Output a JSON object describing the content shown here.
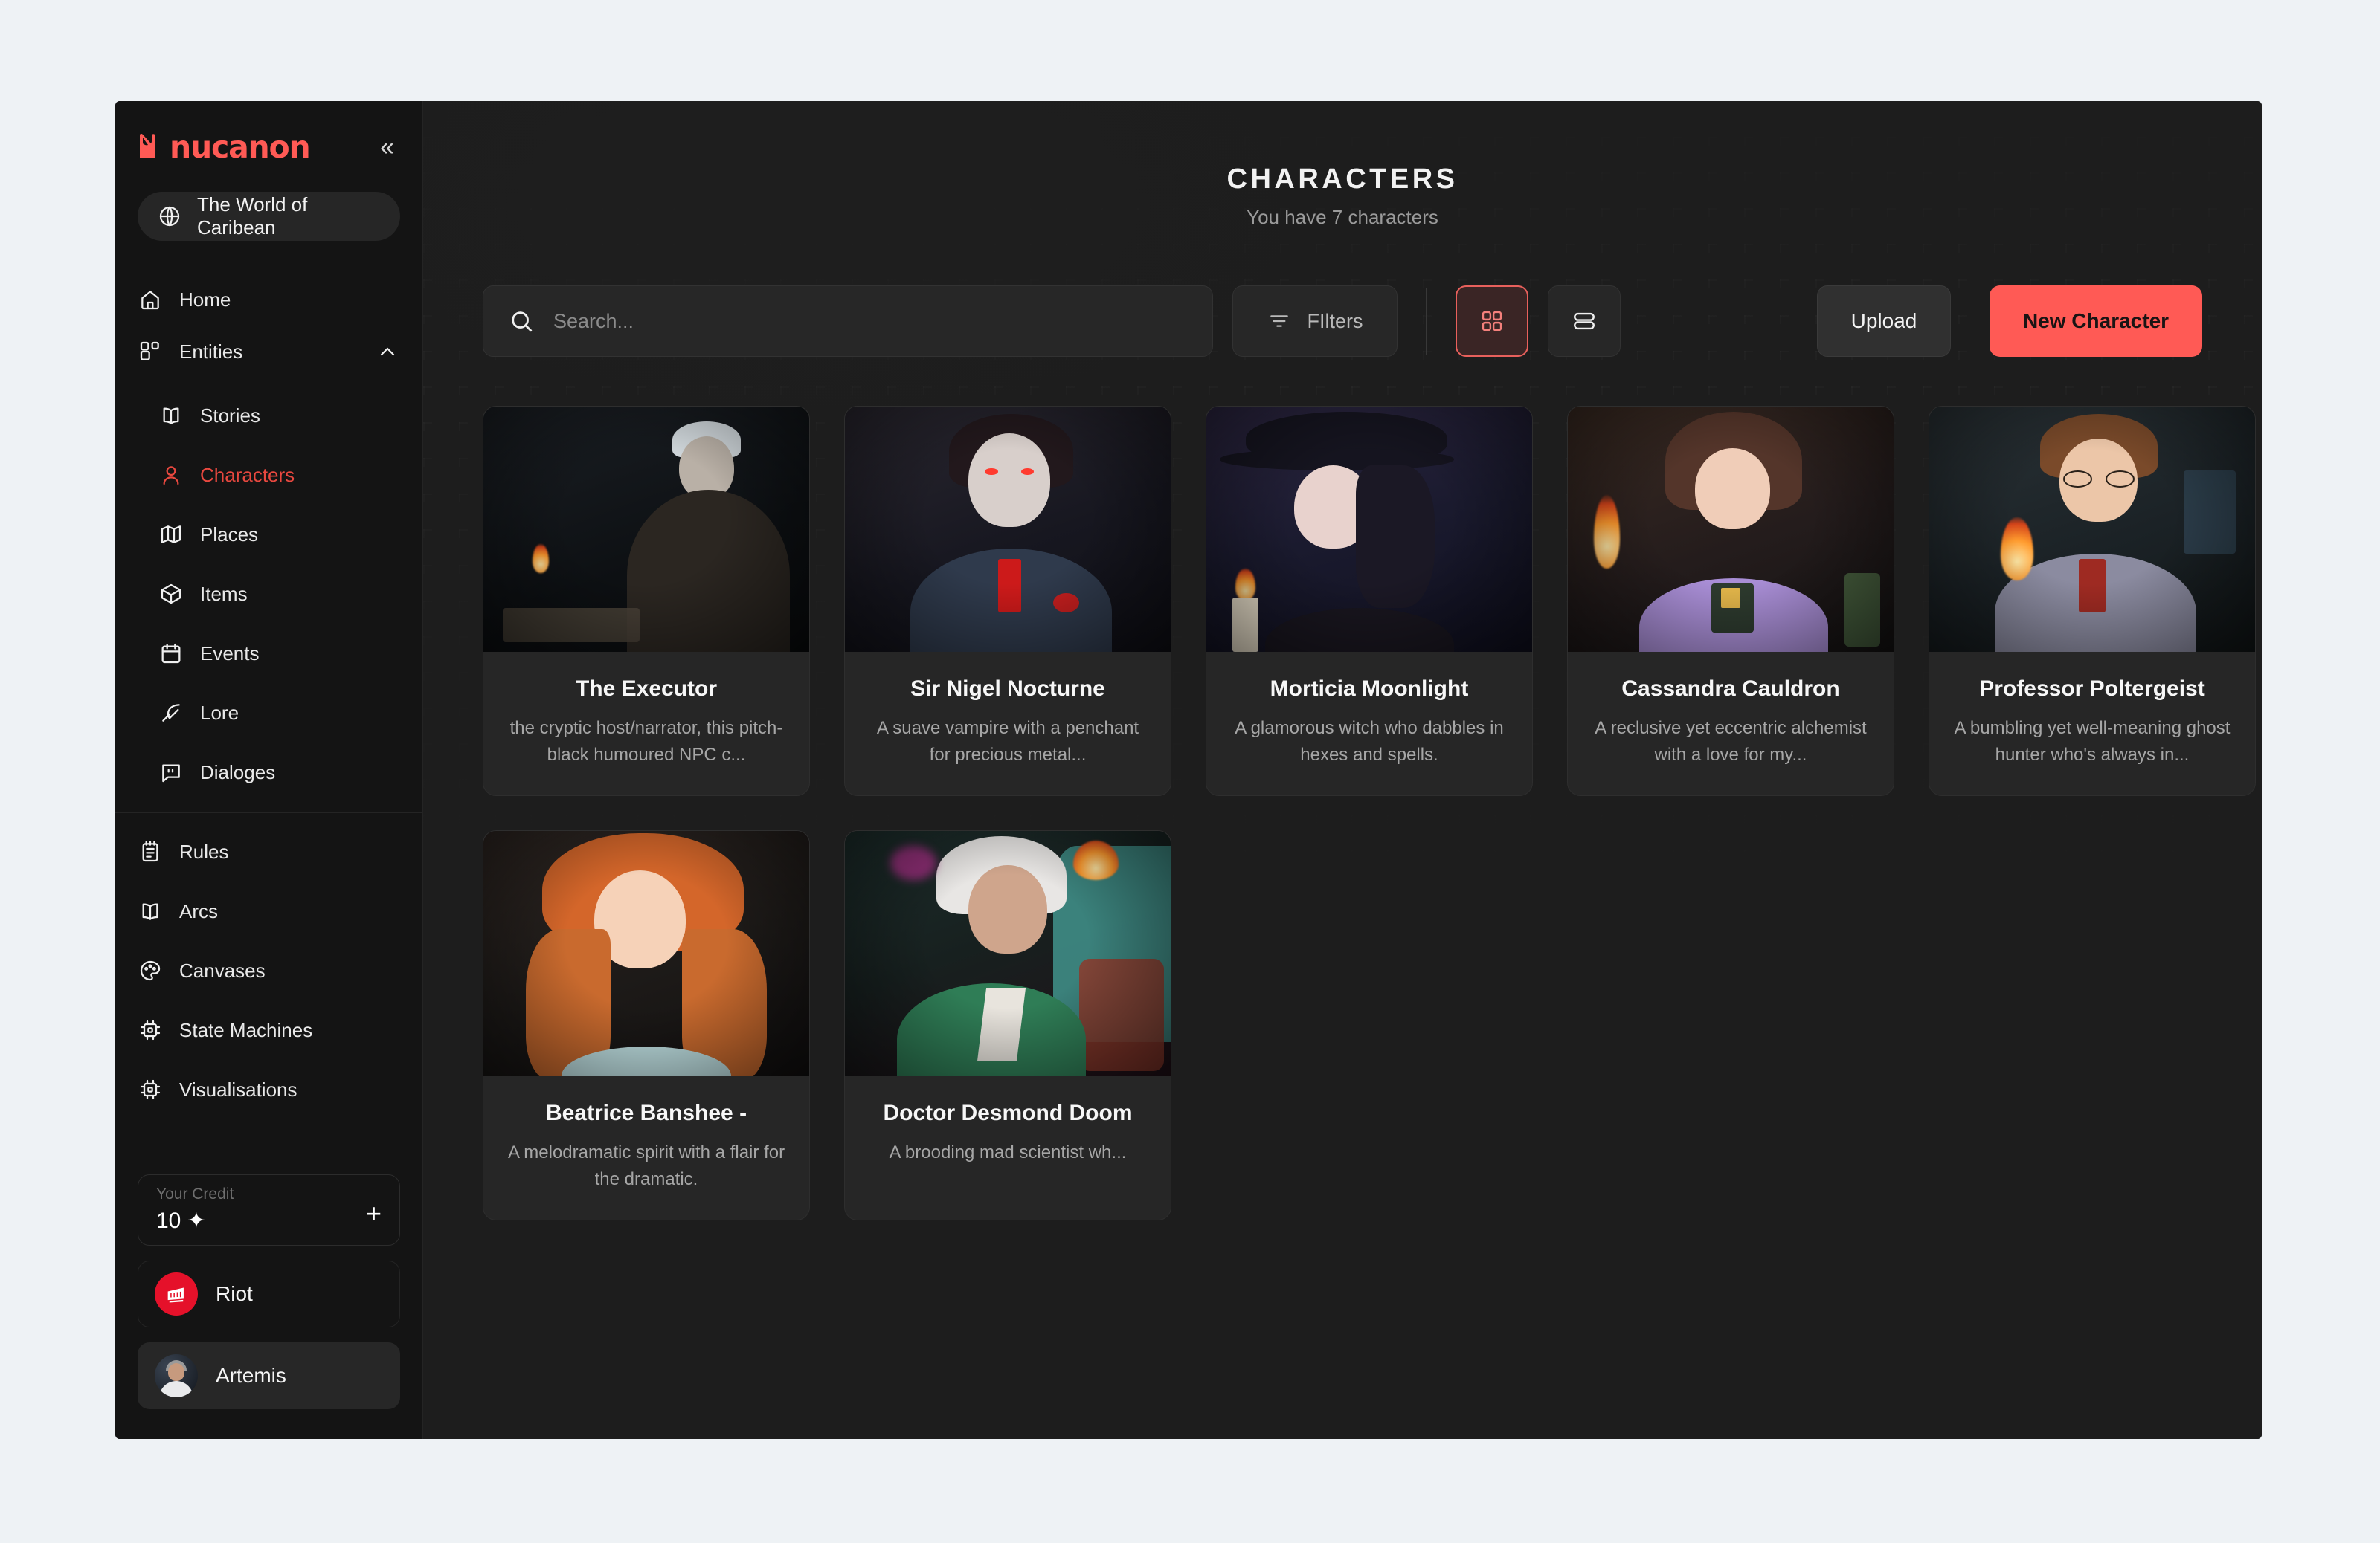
{
  "brand": {
    "name": "nucanon",
    "collapse_icon": "chevrons-left-icon"
  },
  "workspace": {
    "label": "The World of Caribean",
    "icon": "globe-icon"
  },
  "sidebar": {
    "nav": [
      {
        "label": "Home",
        "icon": "home-icon"
      },
      {
        "label": "Entities",
        "icon": "entities-icon",
        "expanded": true,
        "chevron": "chevron-up-icon"
      }
    ],
    "entities_children": [
      {
        "label": "Stories",
        "icon": "book-open-icon",
        "active": false
      },
      {
        "label": "Characters",
        "icon": "user-icon",
        "active": true
      },
      {
        "label": "Places",
        "icon": "map-icon",
        "active": false
      },
      {
        "label": "Items",
        "icon": "box-icon",
        "active": false
      },
      {
        "label": "Events",
        "icon": "calendar-icon",
        "active": false
      },
      {
        "label": "Lore",
        "icon": "feather-icon",
        "active": false
      },
      {
        "label": "Dialoges",
        "icon": "message-quote-icon",
        "active": false
      }
    ],
    "nav_secondary": [
      {
        "label": "Rules",
        "icon": "clipboard-icon"
      },
      {
        "label": "Arcs",
        "icon": "book-open-icon"
      },
      {
        "label": "Canvases",
        "icon": "palette-icon"
      },
      {
        "label": "State Machines",
        "icon": "chip-icon"
      },
      {
        "label": "Visualisations",
        "icon": "chip-icon"
      }
    ],
    "credit": {
      "label": "Your Credit",
      "value": "10",
      "sparkle": "✦",
      "add_icon": "plus-icon"
    },
    "accounts": [
      {
        "name": "Riot",
        "avatar": "riot-fist-logo",
        "selected": false
      },
      {
        "name": "Artemis",
        "avatar": "user-photo",
        "selected": true
      }
    ]
  },
  "header": {
    "title": "CHARACTERS",
    "subtitle": "You have 7 characters"
  },
  "toolbar": {
    "search": {
      "placeholder": "Search...",
      "value": "",
      "icon": "search-icon"
    },
    "filters": {
      "label": "FIlters",
      "icon": "filter-icon"
    },
    "views": [
      {
        "name": "grid",
        "icon": "grid-icon",
        "active": true
      },
      {
        "name": "list",
        "icon": "list-icon",
        "active": false
      }
    ],
    "upload_label": "Upload",
    "new_character_label": "New Character"
  },
  "colors": {
    "accent": "#ff5a55",
    "accent_muted": "#e8483f",
    "app_bg": "#191919",
    "sidebar_bg": "#141414",
    "main_bg": "#1d1d1d",
    "card_bg": "#262626"
  },
  "characters": [
    {
      "name": "The Executor",
      "description": "the cryptic host/narrator, this pitch-black humoured NPC c...",
      "scene": "sc1"
    },
    {
      "name": "Sir Nigel Nocturne",
      "description": "A suave vampire with a penchant for precious metal...",
      "scene": "sc2"
    },
    {
      "name": "Morticia Moonlight",
      "description": "A glamorous witch who dabbles in hexes and spells.",
      "scene": "sc3"
    },
    {
      "name": "Cassandra Cauldron",
      "description": "A reclusive yet eccentric alchemist with a love for my...",
      "scene": "sc4"
    },
    {
      "name": "Professor Poltergeist",
      "description": "A bumbling yet well-meaning ghost hunter who's always in...",
      "scene": "sc5"
    },
    {
      "name": "Beatrice Banshee -",
      "description": "A melodramatic spirit with a flair for the dramatic.",
      "scene": "sc6"
    },
    {
      "name": "Doctor Desmond Doom",
      "description": "A brooding mad scientist wh...",
      "scene": "sc7"
    }
  ]
}
